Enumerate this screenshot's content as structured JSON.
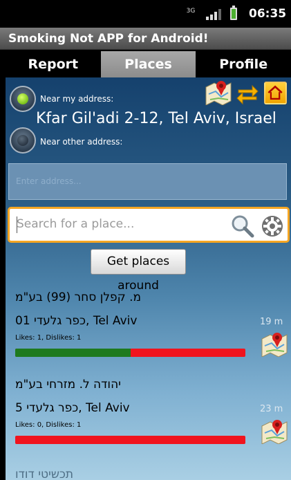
{
  "status_bar": {
    "network": "3G",
    "time": "06:35"
  },
  "app": {
    "title": "Smoking Not APP for Android!"
  },
  "tabs": [
    {
      "label": "Report"
    },
    {
      "label": "Places"
    },
    {
      "label": "Profile"
    }
  ],
  "location": {
    "near_my_address_label": "Near my address:",
    "my_address": "Kfar Gil'adi 2-12, Tel Aviv, Israel",
    "near_other_label": "Near other address:",
    "other_address_placeholder": "Enter address..."
  },
  "search": {
    "placeholder": "Search for a place..."
  },
  "get_places_button": "Get places around",
  "places": [
    {
      "name": "מ. קפלן סחר (99) בע\"מ",
      "address": "כפר גלעדי 01, Tel Aviv",
      "distance": "19 m",
      "likes_text": "Likes: 1, Dislikes: 1",
      "likes": 1,
      "dislikes": 1
    },
    {
      "name": "יהודה ל. מזרחי בע\"מ",
      "address": "כפר גלעדי 5, Tel Aviv",
      "distance": "23 m",
      "likes_text": "Likes: 0, Dislikes: 1",
      "likes": 0,
      "dislikes": 1
    }
  ],
  "partial_next_place": "תכשיטי דודו",
  "colors": {
    "accent": "#f5a623",
    "like": "#1e7a1e",
    "dislike": "#f0141e"
  }
}
